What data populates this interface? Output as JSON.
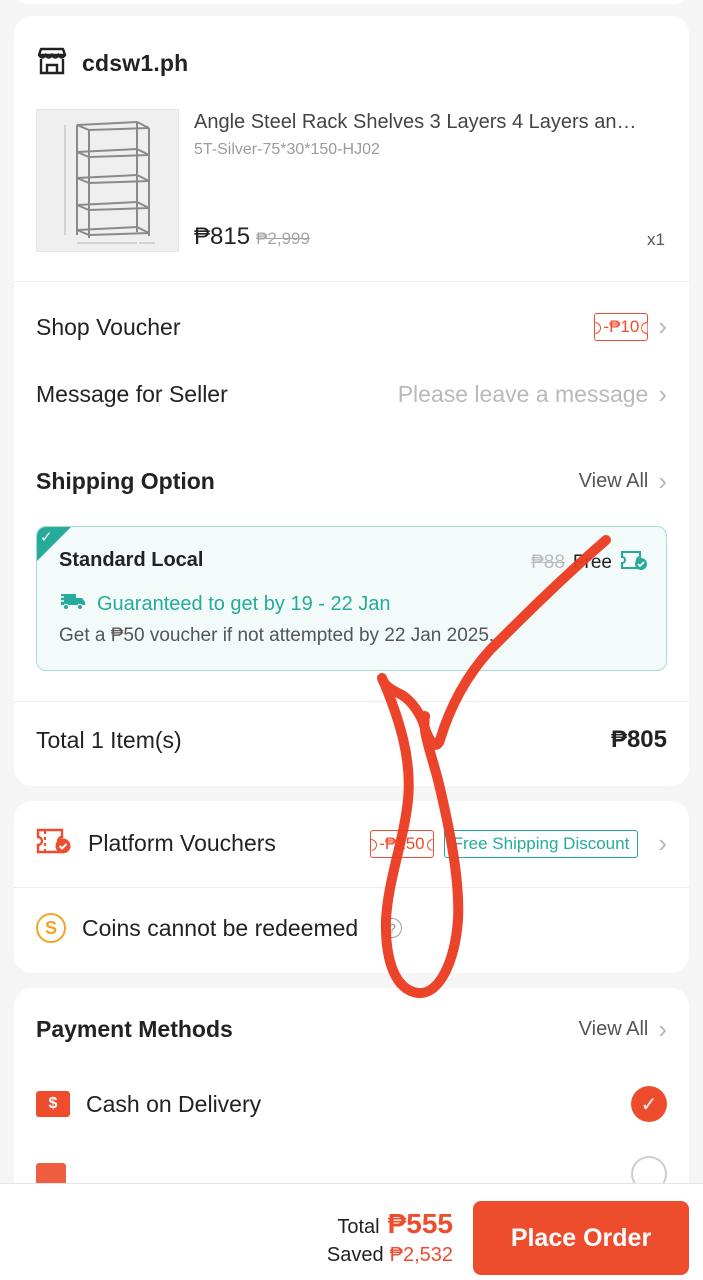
{
  "shop": {
    "name": "cdsw1.ph"
  },
  "product": {
    "title": "Angle Steel Rack Shelves 3 Layers 4 Layers an…",
    "variant": "5T-Silver-75*30*150-HJ02",
    "price": "₱815",
    "original_price": "₱2,999",
    "quantity": "x1"
  },
  "shop_voucher": {
    "label": "Shop Voucher",
    "value": "-₱10"
  },
  "message": {
    "label": "Message for Seller",
    "placeholder": "Please leave a message"
  },
  "shipping": {
    "title": "Shipping Option",
    "view_all": "View All",
    "method": "Standard Local",
    "old_price": "₱88",
    "new_price": "Free",
    "guarantee": "Guaranteed to get by 19 - 22 Jan",
    "note": "Get a ₱50 voucher if not attempted by 22 Jan 2025."
  },
  "order_total": {
    "label": "Total 1 Item(s)",
    "amount": "₱805"
  },
  "platform_vouchers": {
    "label": "Platform Vouchers",
    "discount": "-₱250",
    "free_shipping": "Free Shipping Discount"
  },
  "coins": {
    "label": "Coins cannot be redeemed"
  },
  "payment": {
    "title": "Payment Methods",
    "view_all": "View All",
    "cod_label": "Cash on Delivery"
  },
  "bottom": {
    "total_label": "Total",
    "total_value": "₱555",
    "saved_label": "Saved",
    "saved_value": "₱2,532",
    "place_order": "Place Order"
  },
  "colors": {
    "brand": "#ee4d2d",
    "teal": "#26aa99",
    "checkmark_overlay": "#ea3a1f"
  }
}
